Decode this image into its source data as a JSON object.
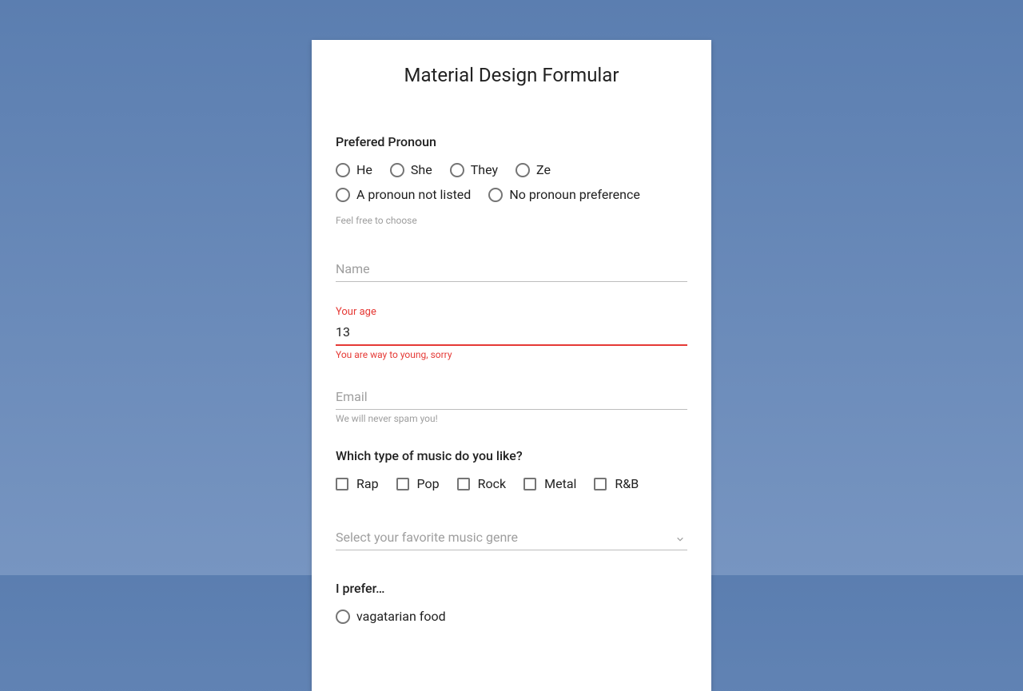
{
  "title": "Material Design Formular",
  "pronoun": {
    "label": "Prefered Pronoun",
    "options": [
      "He",
      "She",
      "They",
      "Ze",
      "A pronoun not listed",
      "No pronoun preference"
    ],
    "helper": "Feel free to choose"
  },
  "name": {
    "placeholder": "Name",
    "value": ""
  },
  "age": {
    "label": "Your age",
    "value": "13",
    "error": "You are way to young, sorry"
  },
  "email": {
    "placeholder": "Email",
    "value": "",
    "helper": "We will never spam you!"
  },
  "music": {
    "label": "Which type of music do you like?",
    "options": [
      "Rap",
      "Pop",
      "Rock",
      "Metal",
      "R&B"
    ]
  },
  "genre_select": {
    "placeholder": "Select your favorite music genre"
  },
  "food": {
    "label": "I prefer…",
    "options": [
      "vagatarian food"
    ]
  }
}
